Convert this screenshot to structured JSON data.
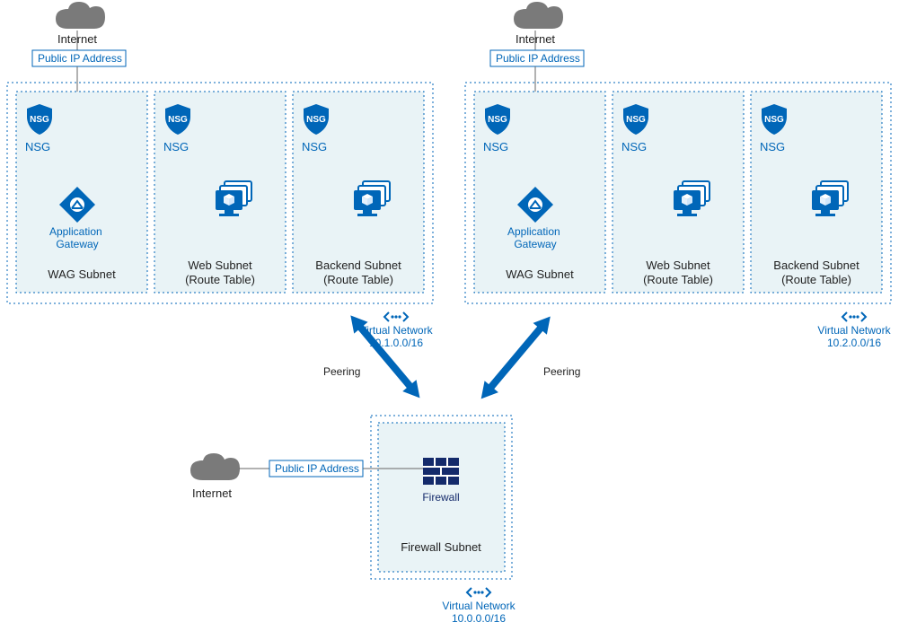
{
  "vnets": [
    {
      "id": "vnet1",
      "internet_label": "Internet",
      "public_ip_label": "Public IP Address",
      "vn_label": "Virtual Network",
      "cidr": "10.1.0.0/16",
      "subnets": [
        {
          "nsg": "NSG",
          "title": "WAG Subnet",
          "subtitle": "",
          "appgw_label": "Application Gateway"
        },
        {
          "nsg": "NSG",
          "title": "Web Subnet",
          "subtitle": "(Route Table)"
        },
        {
          "nsg": "NSG",
          "title": "Backend Subnet",
          "subtitle": "(Route Table)"
        }
      ]
    },
    {
      "id": "vnet2",
      "internet_label": "Internet",
      "public_ip_label": "Public IP Address",
      "vn_label": "Virtual Network",
      "cidr": "10.2.0.0/16",
      "subnets": [
        {
          "nsg": "NSG",
          "title": "WAG Subnet",
          "subtitle": "",
          "appgw_label": "Application Gateway"
        },
        {
          "nsg": "NSG",
          "title": "Web Subnet",
          "subtitle": "(Route Table)"
        },
        {
          "nsg": "NSG",
          "title": "Backend Subnet",
          "subtitle": "(Route Table)"
        }
      ]
    }
  ],
  "peering": {
    "left": "Peering",
    "right": "Peering"
  },
  "hub": {
    "internet_label": "Internet",
    "public_ip_label": "Public IP Address",
    "firewall_label": "Firewall",
    "subnet_title": "Firewall Subnet",
    "vn_label": "Virtual Network",
    "cidr": "10.0.0.0/16"
  }
}
